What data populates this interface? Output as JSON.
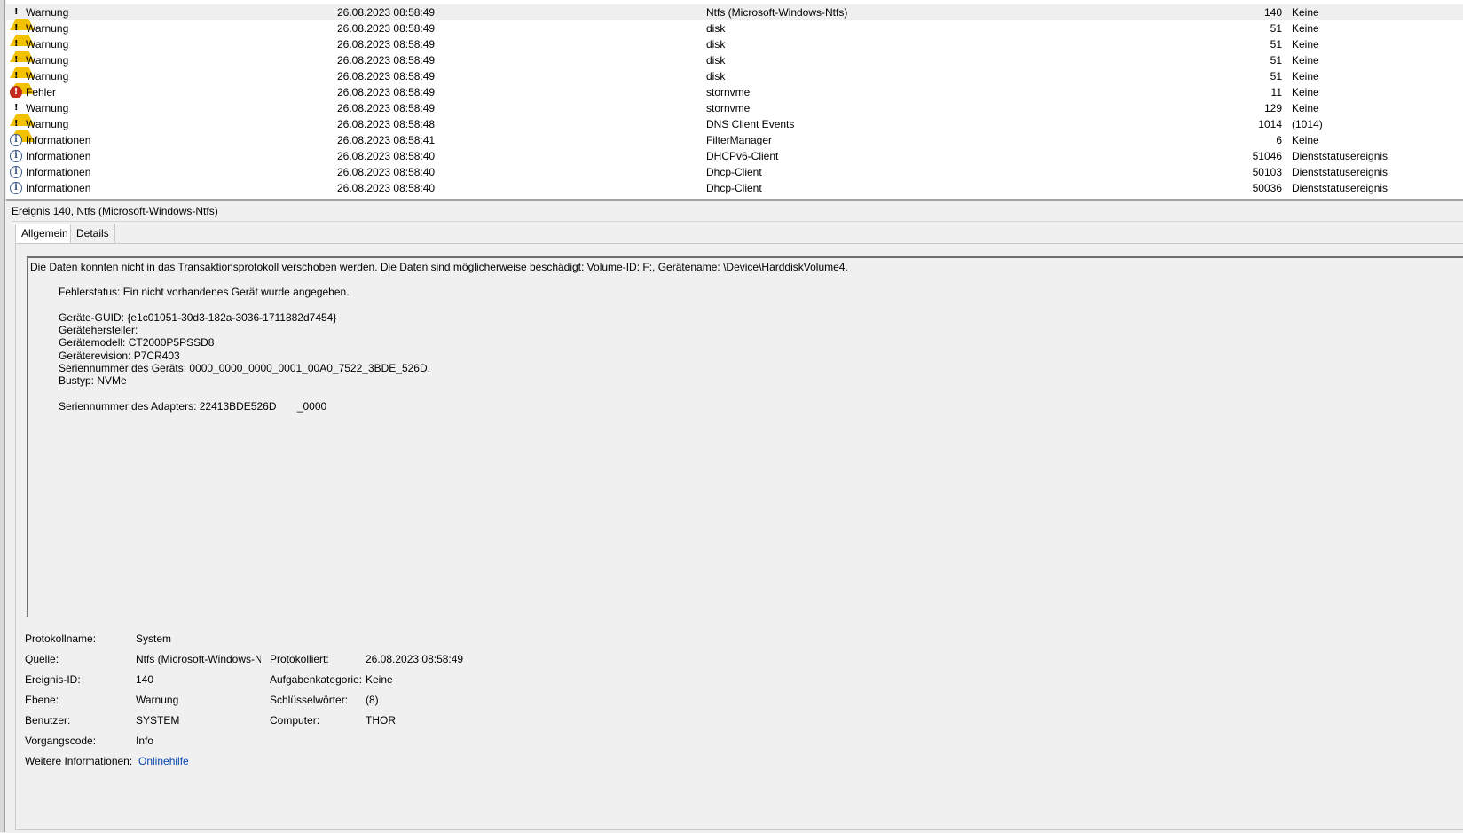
{
  "events": [
    {
      "level": "Warnung",
      "icon": "warning-icon",
      "date": "26.08.2023 08:58:49",
      "source": "Ntfs (Microsoft-Windows-Ntfs)",
      "event_id": "140",
      "category": "Keine",
      "selected": true
    },
    {
      "level": "Warnung",
      "icon": "warning-icon",
      "date": "26.08.2023 08:58:49",
      "source": "disk",
      "event_id": "51",
      "category": "Keine"
    },
    {
      "level": "Warnung",
      "icon": "warning-icon",
      "date": "26.08.2023 08:58:49",
      "source": "disk",
      "event_id": "51",
      "category": "Keine"
    },
    {
      "level": "Warnung",
      "icon": "warning-icon",
      "date": "26.08.2023 08:58:49",
      "source": "disk",
      "event_id": "51",
      "category": "Keine"
    },
    {
      "level": "Warnung",
      "icon": "warning-icon",
      "date": "26.08.2023 08:58:49",
      "source": "disk",
      "event_id": "51",
      "category": "Keine"
    },
    {
      "level": "Fehler",
      "icon": "error-icon",
      "date": "26.08.2023 08:58:49",
      "source": "stornvme",
      "event_id": "11",
      "category": "Keine"
    },
    {
      "level": "Warnung",
      "icon": "warning-icon",
      "date": "26.08.2023 08:58:49",
      "source": "stornvme",
      "event_id": "129",
      "category": "Keine"
    },
    {
      "level": "Warnung",
      "icon": "warning-icon",
      "date": "26.08.2023 08:58:48",
      "source": "DNS Client Events",
      "event_id": "1014",
      "category": "(1014)"
    },
    {
      "level": "Informationen",
      "icon": "information-icon",
      "date": "26.08.2023 08:58:41",
      "source": "FilterManager",
      "event_id": "6",
      "category": "Keine"
    },
    {
      "level": "Informationen",
      "icon": "information-icon",
      "date": "26.08.2023 08:58:40",
      "source": "DHCPv6-Client",
      "event_id": "51046",
      "category": "Dienststatusereignis"
    },
    {
      "level": "Informationen",
      "icon": "information-icon",
      "date": "26.08.2023 08:58:40",
      "source": "Dhcp-Client",
      "event_id": "50103",
      "category": "Dienststatusereignis"
    },
    {
      "level": "Informationen",
      "icon": "information-icon",
      "date": "26.08.2023 08:58:40",
      "source": "Dhcp-Client",
      "event_id": "50036",
      "category": "Dienststatusereignis"
    }
  ],
  "details": {
    "title": "Ereignis 140, Ntfs (Microsoft-Windows-Ntfs)",
    "tabs": [
      "Allgemein",
      "Details"
    ],
    "message": {
      "summary": "Die Daten konnten nicht in das Transaktionsprotokoll verschoben werden. Die Daten sind möglicherweise beschädigt: Volume-ID: F:, Gerätename: \\Device\\HarddiskVolume4.",
      "error_status": "Fehlerstatus: Ein nicht vorhandenes Gerät wurde angegeben.",
      "device_guid": "Geräte-GUID: {e1c01051-30d3-182a-3036-1711882d7454}",
      "manufacturer": "Gerätehersteller:",
      "model": "Gerätemodell: CT2000P5PSSD8",
      "revision": "Geräterevision: P7CR403",
      "serial": "Seriennummer des Geräts: 0000_0000_0000_0001_00A0_7522_3BDE_526D.",
      "bus_type": "Bustyp: NVMe",
      "adapter_serial": "Seriennummer des Adapters: 22413BDE526D       _0000"
    },
    "props": {
      "log_name_label": "Protokollname:",
      "log_name": "System",
      "source_label": "Quelle:",
      "source": "Ntfs (Microsoft-Windows-Ntfs)",
      "logged_label": "Protokolliert:",
      "logged": "26.08.2023 08:58:49",
      "event_id_label": "Ereignis-ID:",
      "event_id": "140",
      "task_category_label": "Aufgabenkategorie:",
      "task_category": "Keine",
      "level_label": "Ebene:",
      "level": "Warnung",
      "keywords_label": "Schlüsselwörter:",
      "keywords": "(8)",
      "user_label": "Benutzer:",
      "user": "SYSTEM",
      "computer_label": "Computer:",
      "computer": "THOR",
      "opcode_label": "Vorgangscode:",
      "opcode": "Info",
      "more_info_label": "Weitere Informationen:",
      "more_info_link": "Onlinehilfe"
    }
  }
}
